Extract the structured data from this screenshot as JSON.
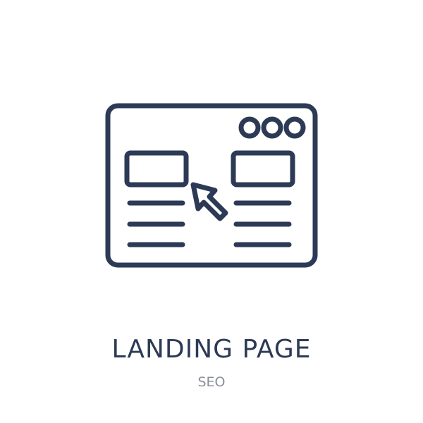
{
  "title": "LANDING PAGE",
  "subtitle": "SEO",
  "icon": {
    "name": "landing-page-icon",
    "parts": [
      "browser-window-icon",
      "window-dots-icon",
      "image-block-icon",
      "text-lines-icon",
      "cursor-arrow-icon"
    ]
  },
  "colors": {
    "icon_stroke": "#2c3a55",
    "title": "#2c3a55",
    "subtitle": "#8a8f99",
    "background": "#ffffff"
  }
}
